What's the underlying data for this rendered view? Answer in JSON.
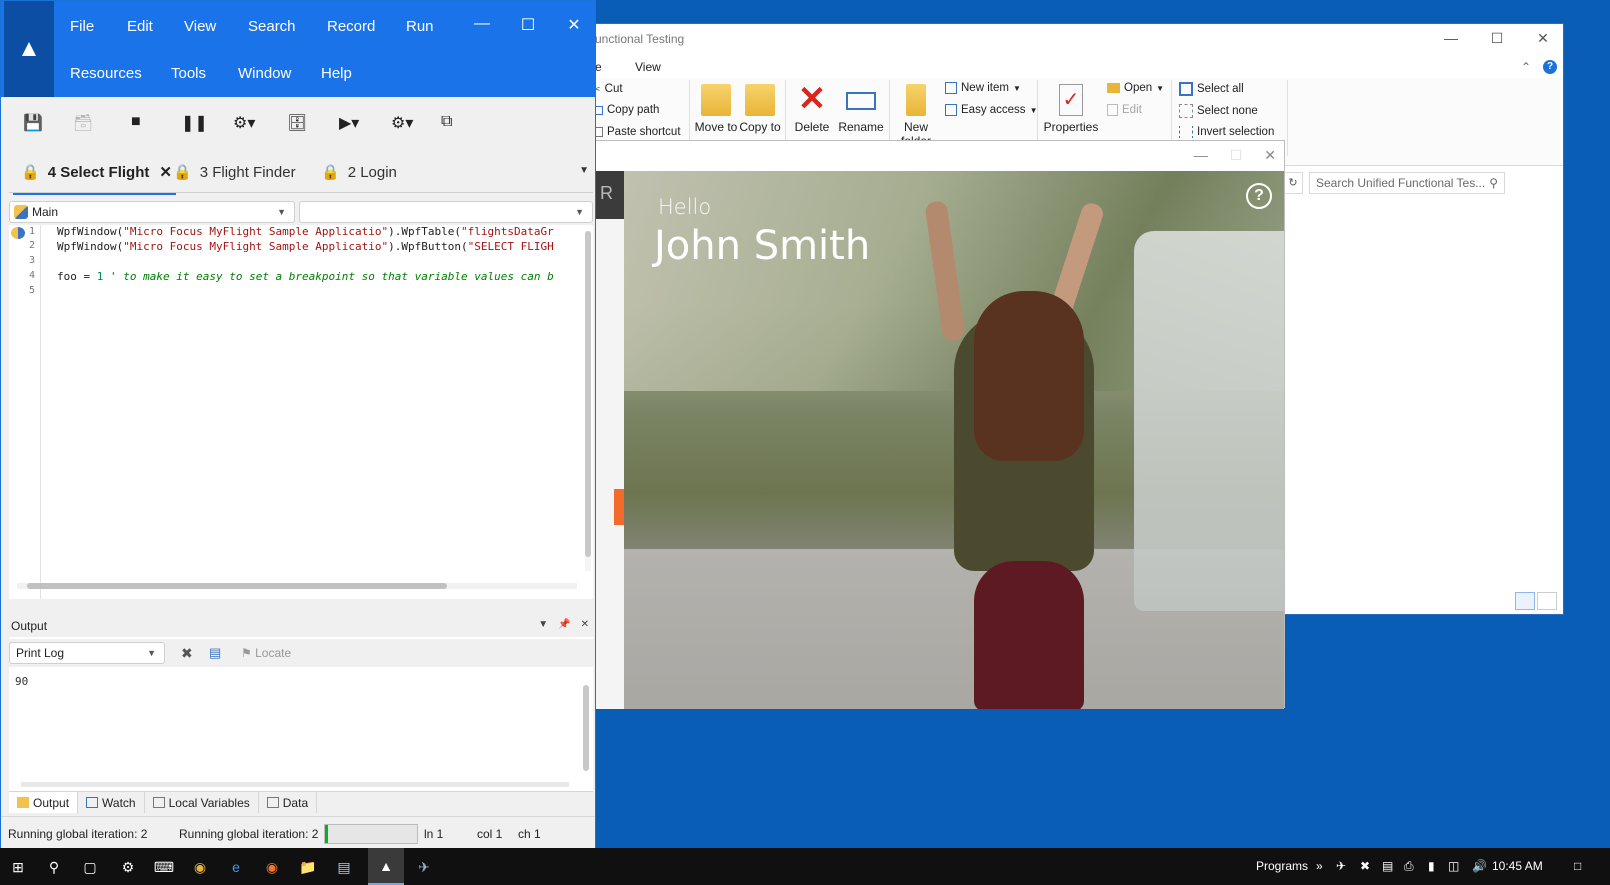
{
  "uft": {
    "menu": [
      "File",
      "Edit",
      "View",
      "Search",
      "Record",
      "Run",
      "Resources",
      "Tools",
      "Window",
      "Help"
    ],
    "tabs": [
      {
        "label": "4 Select Flight",
        "active": true
      },
      {
        "label": "3 Flight Finder",
        "active": false
      },
      {
        "label": "2 Login",
        "active": false
      }
    ],
    "selector_left": "Main",
    "selector_right": "",
    "line_numbers": [
      "1",
      "2",
      "3",
      "4",
      "5"
    ],
    "code": {
      "line1_a": "WpfWindow(",
      "line1_b": "\"Micro Focus MyFlight Sample Applicatio\"",
      "line1_c": ").WpfTable(",
      "line1_d": "\"flightsDataGr",
      "line2_a": "WpfWindow(",
      "line2_b": "\"Micro Focus MyFlight Sample Applicatio\"",
      "line2_c": ").WpfButton(",
      "line2_d": "\"SELECT FLIGH",
      "line4_a": "foo = ",
      "line4_b": "1",
      "line4_c": " ' to make it easy to set a breakpoint so that variable values can b"
    },
    "output": {
      "title": "Output",
      "filter": "Print Log",
      "locate": "Locate",
      "value": "90"
    },
    "bottom_tabs": [
      "Output",
      "Watch",
      "Local Variables",
      "Data"
    ],
    "status": {
      "left": "Running global iteration: 2",
      "middle": "Running global iteration: 2",
      "progress": 0.03,
      "ln": "ln 1",
      "col": "col 1",
      "ch": "ch 1"
    }
  },
  "explorer": {
    "title": "unctional Testing",
    "menu_e": "e",
    "menu_view": "View",
    "ribbon": {
      "cut": "Cut",
      "copy_path": "Copy path",
      "paste_shortcut": "Paste shortcut",
      "move_to": "Move to",
      "copy_to": "Copy to",
      "delete": "Delete",
      "rename": "Rename",
      "new_folder": "New folder",
      "new_item": "New item",
      "easy_access": "Easy access",
      "properties": "Properties",
      "open": "Open",
      "edit": "Edit",
      "select_all": "Select all",
      "select_none": "Select none",
      "invert_selection": "Invert selection"
    },
    "search_placeholder": "Search Unified Functional Tes..."
  },
  "flightapp": {
    "strip_letter": "R",
    "hello": "Hello",
    "user_name": "John Smith",
    "help": "?"
  },
  "taskbar": {
    "programs": "Programs",
    "time": "10:45 AM"
  },
  "colors": {
    "uft_header": "#1a73e8",
    "uft_logo": "#0d4ea5",
    "desktop": "#0a5db4",
    "progress": "#06b025"
  }
}
